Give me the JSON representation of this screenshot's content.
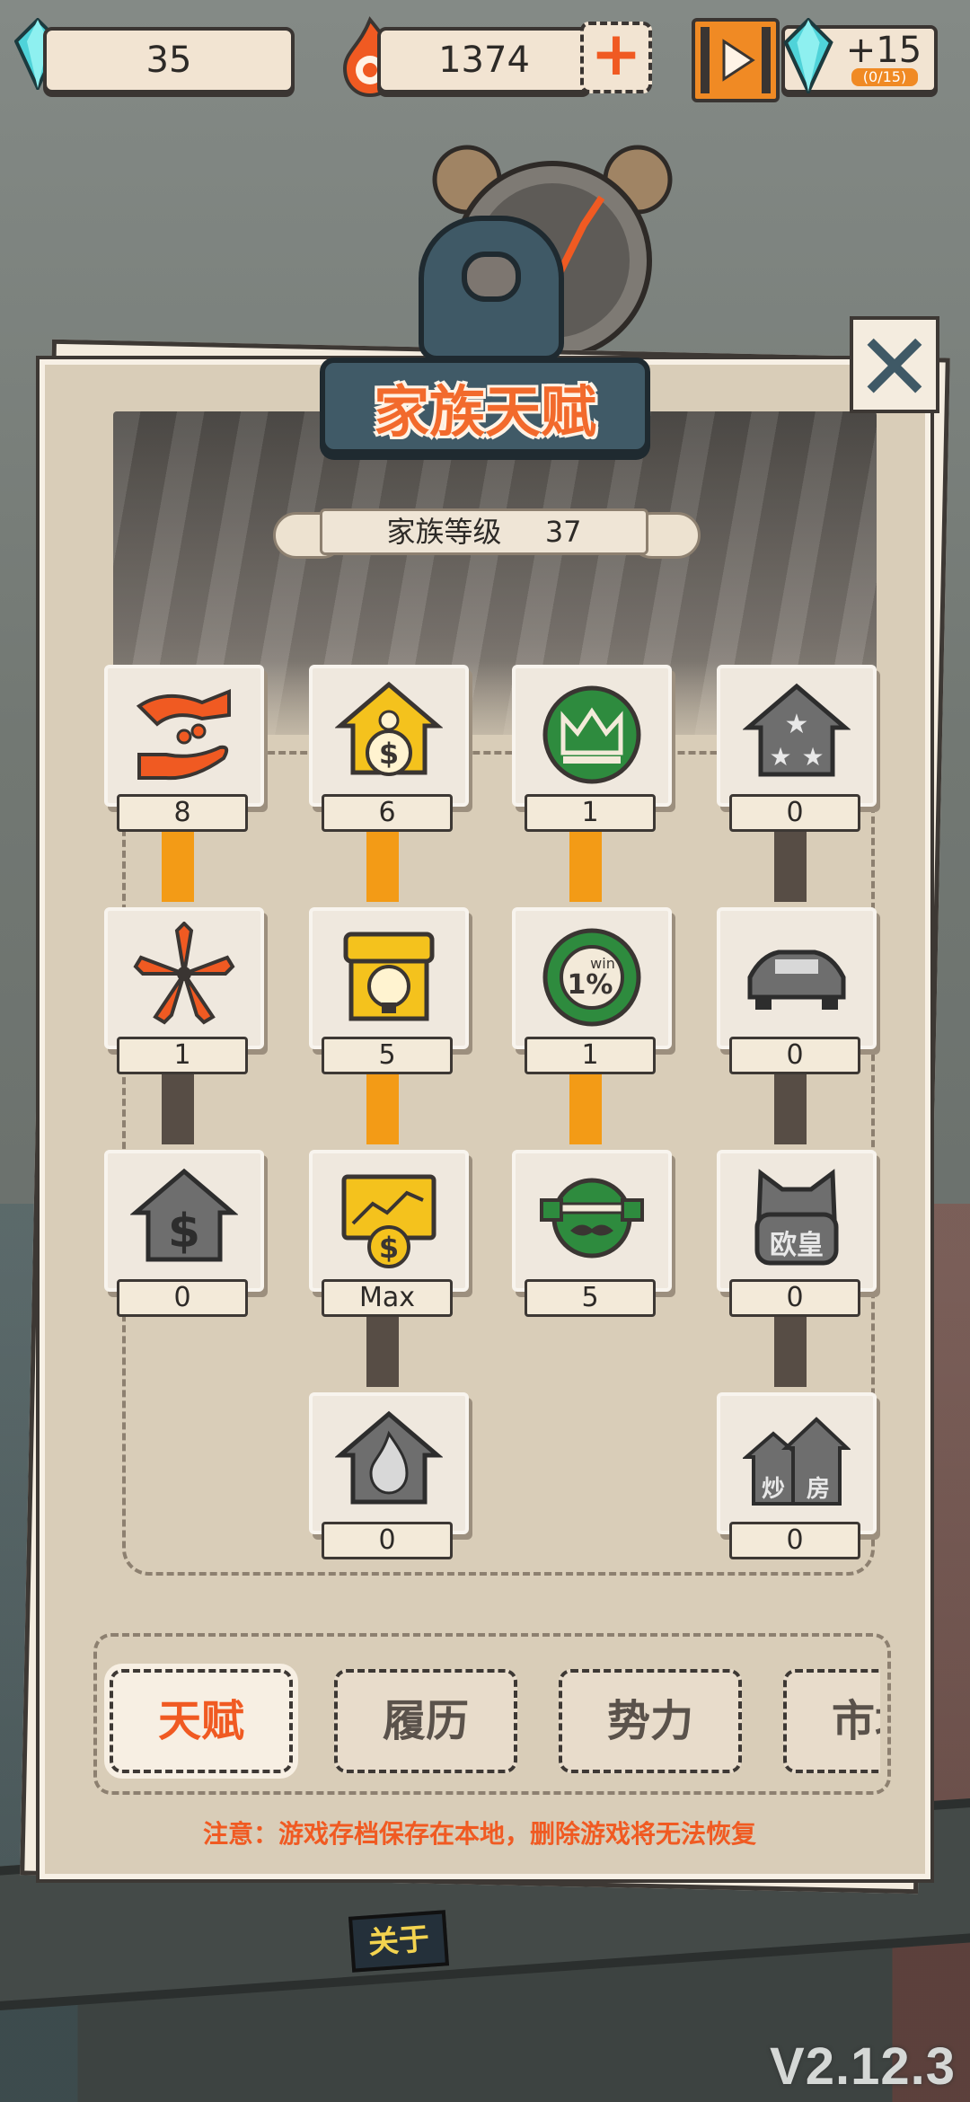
{
  "topbar": {
    "gems": "35",
    "coins": "1374",
    "add_symbol": "+",
    "reward_amount": "+15",
    "reward_count": "(0/15)"
  },
  "panel": {
    "title": "家族天赋",
    "family_level_label": "家族等级",
    "family_level_value": "37"
  },
  "talents": [
    {
      "icon": "handshake-coin-icon",
      "level": "8",
      "color": "#f05a22"
    },
    {
      "icon": "house-money-icon",
      "level": "6",
      "color": "#f4c21d"
    },
    {
      "icon": "crown-icon",
      "level": "1",
      "color": "#2e8b3e"
    },
    {
      "icon": "house-stars-icon",
      "level": "0",
      "color": "#6e6e6e"
    },
    {
      "icon": "flower-icon",
      "level": "1",
      "color": "#f05a22"
    },
    {
      "icon": "shop-bulb-icon",
      "level": "5",
      "color": "#f4c21d"
    },
    {
      "icon": "casino-chip-icon",
      "level": "1",
      "color": "#2e8b3e"
    },
    {
      "icon": "car-icon",
      "level": "0",
      "color": "#6e6e6e"
    },
    {
      "icon": "house-dollar-icon",
      "level": "0",
      "color": "#6e6e6e"
    },
    {
      "icon": "stock-monitor-icon",
      "level": "Max",
      "color": "#f4c21d"
    },
    {
      "icon": "mustache-helmet-icon",
      "level": "5",
      "color": "#2e8b3e"
    },
    {
      "icon": "lucky-cat-icon",
      "level": "0",
      "color": "#6e6e6e"
    },
    {
      "icon": "house-flame-icon",
      "level": "0",
      "color": "#6e6e6e"
    },
    {
      "icon": "house-flip-icon",
      "level": "0",
      "color": "#6e6e6e"
    }
  ],
  "icon_text": {
    "win": "win",
    "one_percent": "1%",
    "cat": "欧皇",
    "flip_a": "炒",
    "flip_b": "房"
  },
  "tabs": [
    {
      "label": "天赋",
      "active": true
    },
    {
      "label": "履历",
      "active": false
    },
    {
      "label": "势力",
      "active": false
    },
    {
      "label": "市场",
      "active": false
    }
  ],
  "notice": "注意：游戏存档保存在本地，删除游戏将无法恢复",
  "background": {
    "truck_sign": "关于",
    "version": "V2.12.3"
  }
}
